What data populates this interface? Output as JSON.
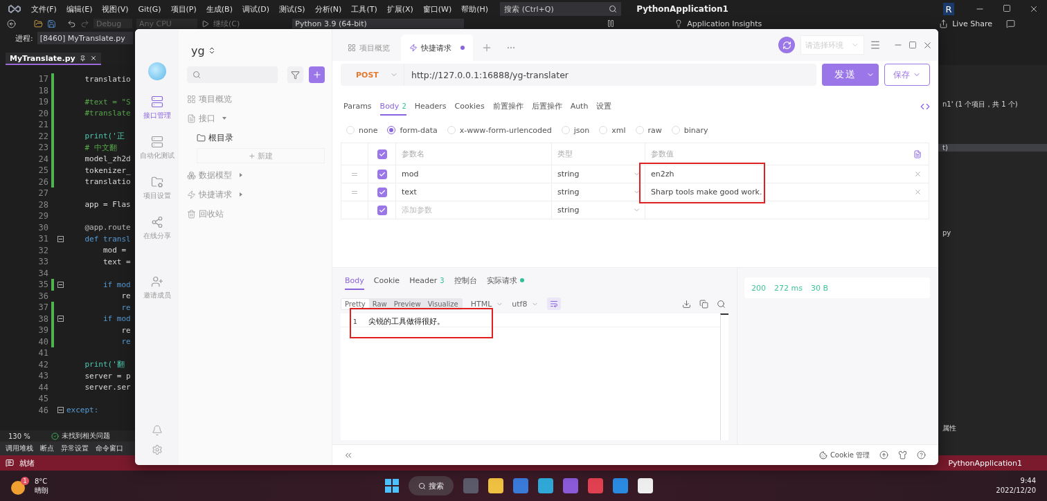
{
  "ide": {
    "menu": [
      "文件(F)",
      "编辑(E)",
      "视图(V)",
      "Git(G)",
      "项目(P)",
      "生成(B)",
      "调试(D)",
      "测试(S)",
      "分析(N)",
      "工具(T)",
      "扩展(X)",
      "窗口(W)",
      "帮助(H)"
    ],
    "search": {
      "placeholder": "搜索 (Ctrl+Q)"
    },
    "solution": "PythonApplication1",
    "account": "R",
    "toolbar": {
      "configuration": "Debug",
      "platform": "Any CPU",
      "continue": "继续(C)",
      "environment": "Python 3.9 (64-bit)",
      "insights": "Application Insights",
      "live_share": "Live Share"
    },
    "process": {
      "label": "进程:",
      "value": "[8460] MyTranslate.py"
    },
    "document_tab": "MyTranslate.py",
    "code_lines": [
      {
        "number": "17",
        "text": "    translatio",
        "kind": "plain",
        "changed": true,
        "fold": false
      },
      {
        "number": "18",
        "changed": true,
        "fold": false
      },
      {
        "number": "19",
        "text": "    #text = \"S",
        "kind": "comment",
        "changed": true,
        "fold": false
      },
      {
        "number": "20",
        "text": "    #translate",
        "kind": "comment",
        "changed": true,
        "fold": false
      },
      {
        "number": "21",
        "changed": true,
        "fold": false
      },
      {
        "number": "22",
        "text": "    print('正",
        "kind": "call",
        "changed": true,
        "fold": false
      },
      {
        "number": "23",
        "text": "    # 中文翻",
        "kind": "comment",
        "changed": true,
        "fold": false
      },
      {
        "number": "24",
        "text": "    model_zh2d",
        "kind": "plain",
        "changed": true,
        "fold": false
      },
      {
        "number": "25",
        "text": "    tokenizer_",
        "kind": "plain",
        "changed": true,
        "fold": false
      },
      {
        "number": "26",
        "text": "    translatio",
        "kind": "plain",
        "changed": true,
        "fold": false
      },
      {
        "number": "27",
        "changed": false,
        "fold": false
      },
      {
        "number": "28",
        "text": "    app = Flas",
        "kind": "plain",
        "changed": false,
        "fold": false
      },
      {
        "number": "29",
        "changed": false,
        "fold": false
      },
      {
        "number": "30",
        "text": "    @app.route",
        "kind": "decorator",
        "changed": false,
        "fold": false
      },
      {
        "number": "31",
        "text": "    def transl",
        "kind": "keyword",
        "changed": false,
        "fold": true
      },
      {
        "number": "32",
        "text": "        mod =",
        "kind": "plain",
        "changed": false,
        "fold": false
      },
      {
        "number": "33",
        "text": "        text =",
        "kind": "plain",
        "changed": false,
        "fold": false
      },
      {
        "number": "34",
        "changed": false,
        "fold": false
      },
      {
        "number": "35",
        "text": "        if mod",
        "kind": "keyword",
        "changed": true,
        "fold": true
      },
      {
        "number": "36",
        "text": "            re",
        "kind": "plain",
        "changed": false,
        "fold": false
      },
      {
        "number": "37",
        "text": "            re",
        "kind": "keyword",
        "changed": true,
        "fold": false
      },
      {
        "number": "38",
        "text": "        if mod",
        "kind": "keyword",
        "changed": true,
        "fold": true
      },
      {
        "number": "39",
        "text": "            re",
        "kind": "plain",
        "changed": true,
        "fold": false
      },
      {
        "number": "40",
        "text": "            re",
        "kind": "keyword",
        "changed": true,
        "fold": false
      },
      {
        "number": "41",
        "changed": false,
        "fold": false
      },
      {
        "number": "42",
        "text": "    print('翻",
        "kind": "call",
        "changed": false,
        "fold": false
      },
      {
        "number": "43",
        "text": "    server = p",
        "kind": "plain",
        "changed": false,
        "fold": false
      },
      {
        "number": "44",
        "text": "    server.ser",
        "kind": "plain",
        "changed": false,
        "fold": false
      },
      {
        "number": "45",
        "changed": false,
        "fold": false
      },
      {
        "number": "46",
        "text": "except:",
        "kind": "keyword",
        "changed": false,
        "fold": true
      }
    ],
    "zoom": "130 %",
    "issues": "未找到相关问题",
    "bottom_tabs": [
      "调用堆栈",
      "断点",
      "异常设置",
      "命令窗口"
    ],
    "side_texts": [
      "n1' (1 个项目，共 1 个)",
      "t)",
      "py",
      "属性"
    ],
    "status": "就绪",
    "status_project": "PythonApplication1"
  },
  "taskbar": {
    "weather": {
      "badge": "1",
      "temperature": "8°C",
      "condition": "晴朗"
    },
    "search": "搜索",
    "time": "9:44",
    "date": "2022/12/20"
  },
  "app": {
    "rail": [
      {
        "label": "接口管理",
        "selected": true
      },
      {
        "label": "自动化测试",
        "selected": false
      },
      {
        "label": "项目设置",
        "selected": false
      },
      {
        "label": "在线分享",
        "selected": false
      },
      {
        "label": "邀请成员",
        "selected": false
      }
    ],
    "project": "yg",
    "tree": [
      {
        "label": "项目概览",
        "kind": "overview"
      },
      {
        "label": "接口",
        "kind": "api",
        "expanded": true,
        "children": [
          {
            "label": "根目录",
            "kind": "folder"
          }
        ]
      },
      {
        "label": "数据模型",
        "kind": "model",
        "expanded": false
      },
      {
        "label": "快捷请求",
        "kind": "quick",
        "expanded": false
      },
      {
        "label": "回收站",
        "kind": "trash"
      }
    ],
    "new_button": "+ 新建",
    "tabs": [
      {
        "label": "项目概览",
        "selected": false,
        "unsaved": false
      },
      {
        "label": "快捷请求",
        "selected": true,
        "unsaved": true
      }
    ],
    "environment": {
      "placeholder": "请选择环境"
    },
    "request": {
      "method": "POST",
      "url": "http://127.0.0.1:16888/yg-translater",
      "send": "发送",
      "save": "保存"
    },
    "request_tabs": [
      {
        "label": "Params",
        "selected": false
      },
      {
        "label": "Body",
        "count": "2",
        "selected": true
      },
      {
        "label": "Headers",
        "selected": false
      },
      {
        "label": "Cookies",
        "selected": false
      },
      {
        "label": "前置操作",
        "selected": false
      },
      {
        "label": "后置操作",
        "selected": false
      },
      {
        "label": "Auth",
        "selected": false
      },
      {
        "label": "设置",
        "selected": false
      }
    ],
    "body_types": [
      {
        "label": "none",
        "selected": false
      },
      {
        "label": "form-data",
        "selected": true
      },
      {
        "label": "x-www-form-urlencoded",
        "selected": false
      },
      {
        "label": "json",
        "selected": false
      },
      {
        "label": "xml",
        "selected": false
      },
      {
        "label": "raw",
        "selected": false
      },
      {
        "label": "binary",
        "selected": false
      }
    ],
    "params": {
      "columns": [
        "参数名",
        "类型",
        "参数值"
      ],
      "all_checked": true,
      "rows": [
        {
          "name": "mod",
          "type": "string",
          "value": "en2zh",
          "checked": true
        },
        {
          "name": "text",
          "type": "string",
          "value": "Sharp tools make good work.",
          "checked": true
        }
      ],
      "new_row": {
        "placeholder": "添加参数",
        "type": "string",
        "checked": true
      }
    },
    "response_tabs": [
      {
        "label": "Body",
        "selected": true,
        "live": false
      },
      {
        "label": "Cookie",
        "selected": false,
        "live": false
      },
      {
        "label": "Header",
        "count": "3",
        "selected": false,
        "live": false
      },
      {
        "label": "控制台",
        "selected": false,
        "live": false
      },
      {
        "label": "实际请求",
        "selected": false,
        "live": true
      }
    ],
    "view_modes": [
      {
        "label": "Pretty",
        "selected": true
      },
      {
        "label": "Raw",
        "selected": false
      },
      {
        "label": "Preview",
        "selected": false
      },
      {
        "label": "Visualize",
        "selected": false
      }
    ],
    "format": "HTML",
    "encoding": "utf8",
    "response_lines": [
      {
        "number": "1",
        "text": "尖锐的工具做得很好。"
      }
    ],
    "stats": [
      "200",
      "272 ms",
      "30 B"
    ],
    "cookie_manager": "Cookie 管理"
  }
}
